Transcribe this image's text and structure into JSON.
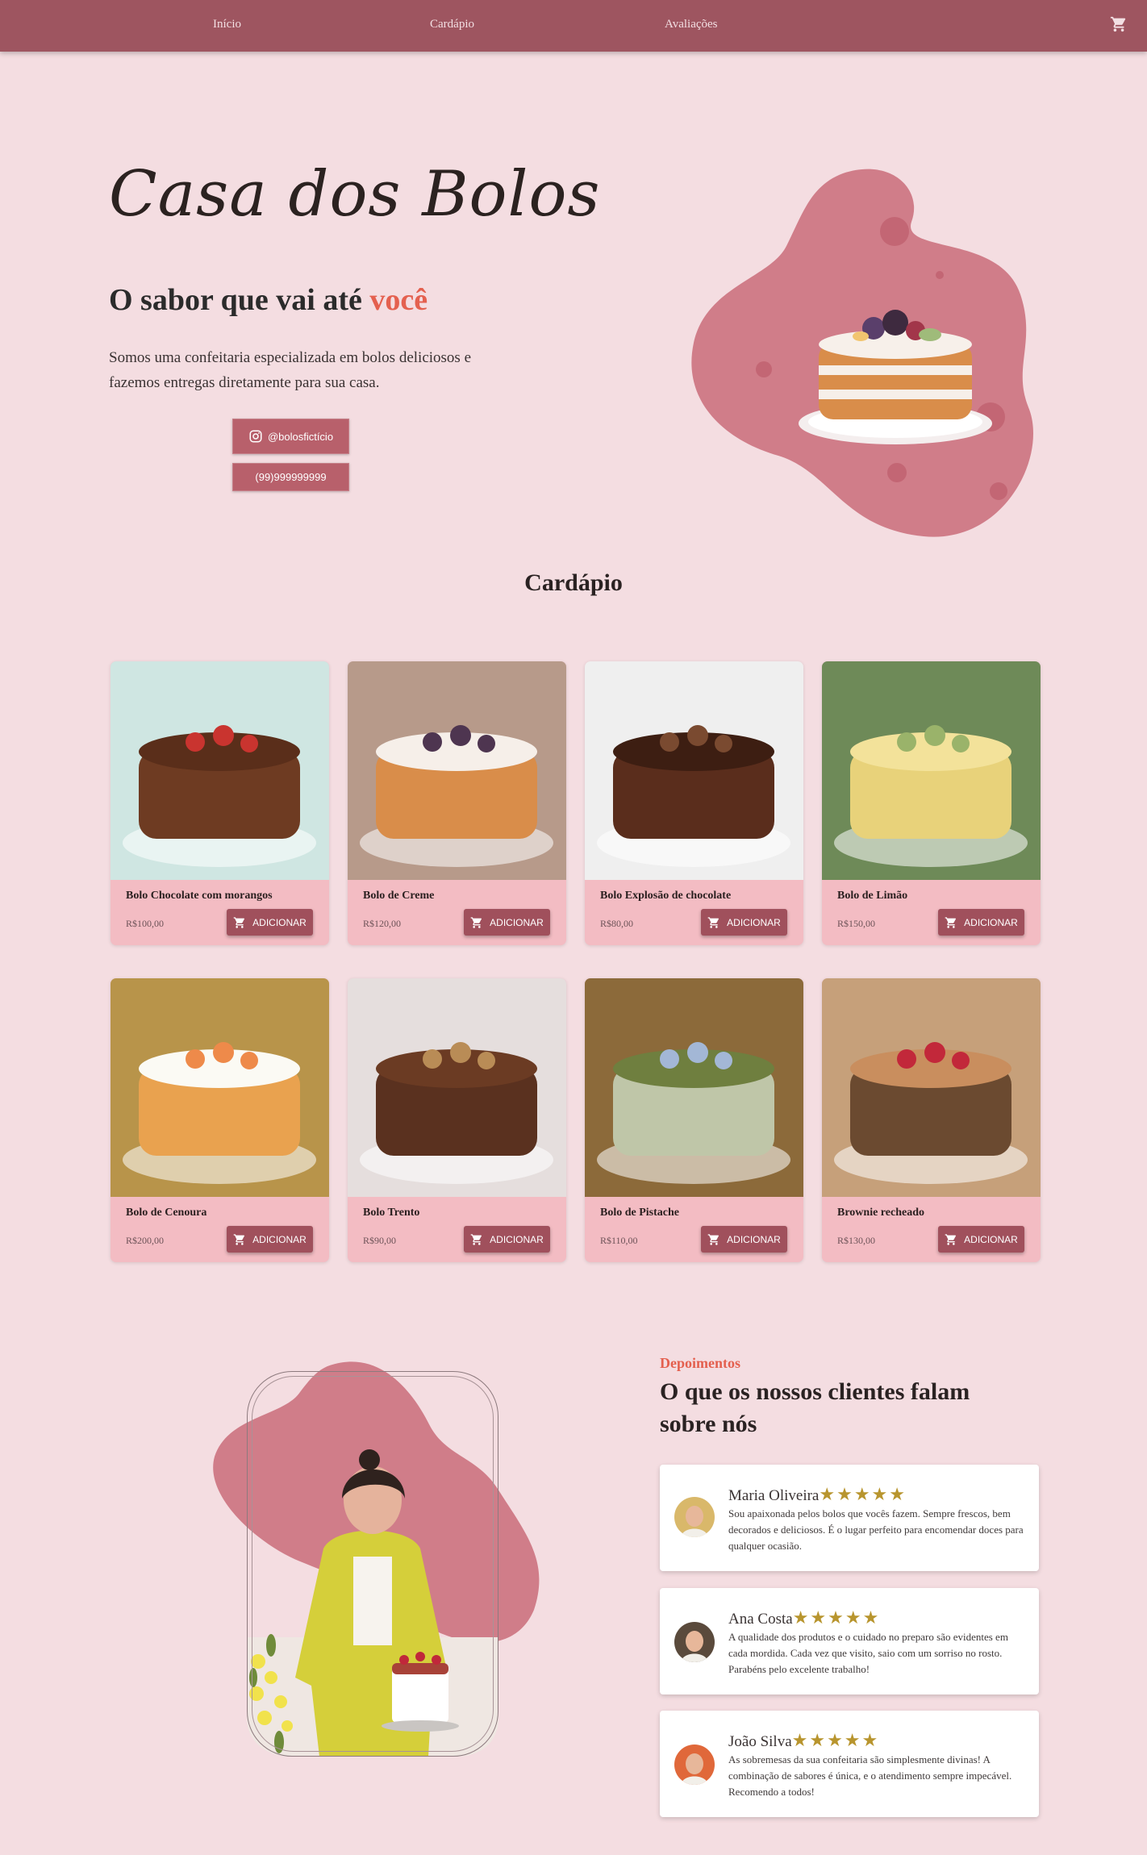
{
  "nav": {
    "links": [
      "Início",
      "Cardápio",
      "Avaliações"
    ],
    "cart_icon": "cart-icon"
  },
  "hero": {
    "title": "Casa dos Bolos",
    "subtitle_prefix": "O sabor que vai até",
    "subtitle_highlight": "você",
    "description": "Somos uma confeitaria especializada em bolos deliciosos e fazemos entregas diretamente para sua casa.",
    "instagram": "@bolosfictício",
    "phone": "(99)999999999"
  },
  "menu": {
    "title": "Cardápio",
    "add_label": "ADICIONAR",
    "items": [
      {
        "name": "Bolo Chocolate com morangos",
        "price": "R$100,00"
      },
      {
        "name": "Bolo de Creme",
        "price": "R$120,00"
      },
      {
        "name": "Bolo Explosão de chocolate",
        "price": "R$80,00"
      },
      {
        "name": "Bolo de Limão",
        "price": "R$150,00"
      },
      {
        "name": "Bolo de Cenoura",
        "price": "R$200,00"
      },
      {
        "name": "Bolo Trento",
        "price": "R$90,00"
      },
      {
        "name": "Bolo de Pistache",
        "price": "R$110,00"
      },
      {
        "name": "Brownie recheado",
        "price": "R$130,00"
      }
    ]
  },
  "testimonials": {
    "label": "Depoimentos",
    "title": "O que os nossos clientes falam sobre nós",
    "stars": "★★★★★",
    "items": [
      {
        "name": "Maria Oliveira",
        "text": "Sou apaixonada pelos bolos que vocês fazem. Sempre frescos, bem decorados e deliciosos. É o lugar perfeito para encomendar doces para qualquer ocasião."
      },
      {
        "name": "Ana Costa",
        "text": "A qualidade dos produtos e o cuidado no preparo são evidentes em cada mordida. Cada vez que visito, saio com um sorriso no rosto. Parabéns pelo excelente trabalho!"
      },
      {
        "name": "João Silva",
        "text": "As sobremesas da sua confeitaria são simplesmente divinas! A combinação de sabores é única, e o atendimento sempre impecável. Recomendo a todos!"
      }
    ]
  },
  "colors": {
    "accent": "#9e5560",
    "highlight": "#e4604f",
    "background": "#f4dde1",
    "card": "#f3bcc3",
    "blob": "#d07d89"
  }
}
